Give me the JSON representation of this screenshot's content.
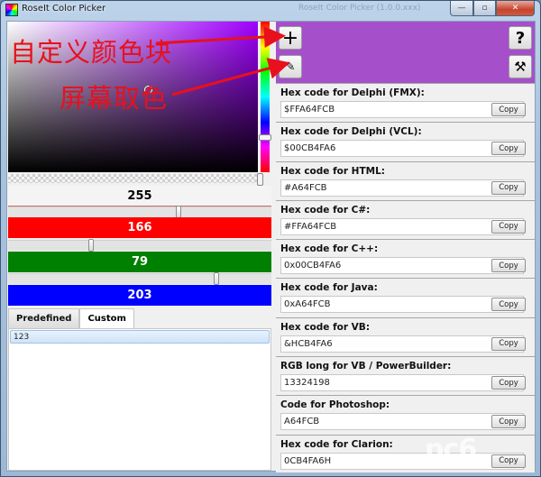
{
  "window": {
    "title": "RoseIt Color Picker",
    "background_window_title": "RoseIt Color Picker (1.0.0.xxx)",
    "controls": {
      "minimize": "—",
      "maximize": "▫",
      "close": "✕"
    }
  },
  "color": {
    "hex": "#A64FCB",
    "alpha": "255",
    "red": "166",
    "green": "79",
    "blue": "203",
    "slider_fractions": {
      "alpha": 1.0,
      "red": 0.651,
      "green": 0.31,
      "blue": 0.796
    }
  },
  "tabs": [
    {
      "label": "Predefined",
      "active": false
    },
    {
      "label": "Custom",
      "active": true
    }
  ],
  "custom_list": [
    "123"
  ],
  "buttons": {
    "add_custom": "+",
    "eyedropper": "✎",
    "help": "?",
    "tools": "⚒"
  },
  "codes": [
    {
      "label": "Hex code for Delphi (FMX):",
      "value": "$FFA64FCB",
      "copy": "Copy"
    },
    {
      "label": "Hex code for Delphi (VCL):",
      "value": "$00CB4FA6",
      "copy": "Copy"
    },
    {
      "label": "Hex code for HTML:",
      "value": "#A64FCB",
      "copy": "Copy"
    },
    {
      "label": "Hex code for C#:",
      "value": "#FFA64FCB",
      "copy": "Copy"
    },
    {
      "label": "Hex code for C++:",
      "value": "0x00CB4FA6",
      "copy": "Copy"
    },
    {
      "label": "Hex code for Java:",
      "value": "0xA64FCB",
      "copy": "Copy"
    },
    {
      "label": "Hex code for VB:",
      "value": "&HCB4FA6",
      "copy": "Copy"
    },
    {
      "label": "RGB long for VB / PowerBuilder:",
      "value": "13324198",
      "copy": "Copy"
    },
    {
      "label": "Code for Photoshop:",
      "value": "A64FCB",
      "copy": "Copy"
    },
    {
      "label": "Hex code for Clarion:",
      "value": "0CB4FA6H",
      "copy": "Copy"
    }
  ],
  "annotations": {
    "custom_color_block": "自定义颜色块",
    "screen_pick": "屏幕取色"
  },
  "watermark": "pc6"
}
